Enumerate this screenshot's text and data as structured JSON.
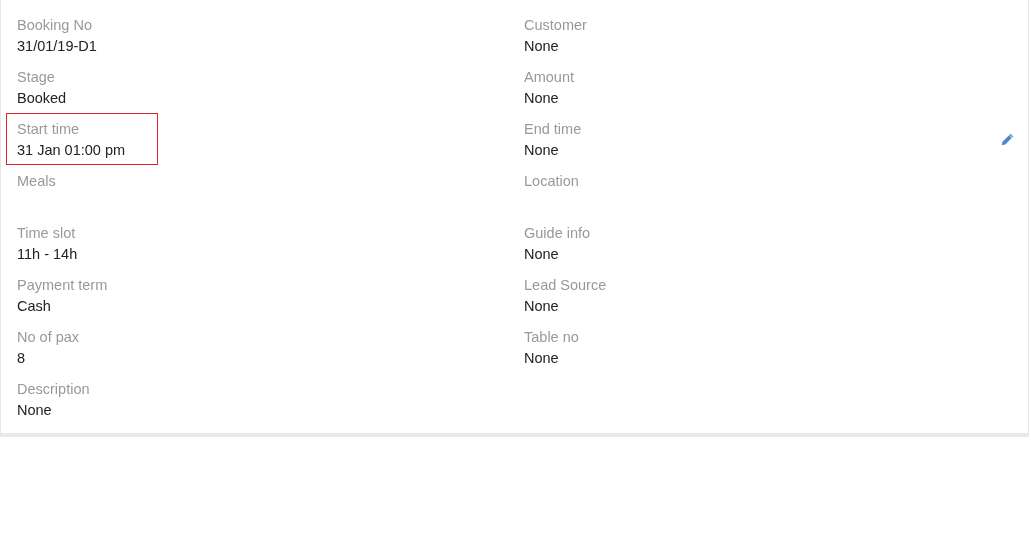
{
  "fields": [
    {
      "label": "Booking No",
      "value": "31/01/19-D1",
      "highlighted": false,
      "editable": false
    },
    {
      "label": "Customer",
      "value": "None",
      "highlighted": false,
      "editable": false
    },
    {
      "label": "Stage",
      "value": "Booked",
      "highlighted": false,
      "editable": false
    },
    {
      "label": "Amount",
      "value": "None",
      "highlighted": false,
      "editable": false
    },
    {
      "label": "Start time",
      "value": "31 Jan 01:00 pm",
      "highlighted": true,
      "editable": false
    },
    {
      "label": "End time",
      "value": "None",
      "highlighted": false,
      "editable": true
    },
    {
      "label": "Meals",
      "highlighted": false,
      "editable": false
    },
    {
      "label": "Location",
      "highlighted": false,
      "editable": false
    },
    {
      "label": "Time slot",
      "value": "11h - 14h",
      "highlighted": false,
      "editable": false
    },
    {
      "label": "Guide info",
      "value": "None",
      "highlighted": false,
      "editable": false
    },
    {
      "label": "Payment term",
      "value": "Cash",
      "highlighted": false,
      "editable": false
    },
    {
      "label": "Lead Source",
      "value": "None",
      "highlighted": false,
      "editable": false
    },
    {
      "label": "No of pax",
      "value": "8",
      "highlighted": false,
      "editable": false
    },
    {
      "label": "Table no",
      "value": "None",
      "highlighted": false,
      "editable": false
    },
    {
      "label": "Description",
      "value": "None",
      "highlighted": false,
      "editable": false
    }
  ]
}
